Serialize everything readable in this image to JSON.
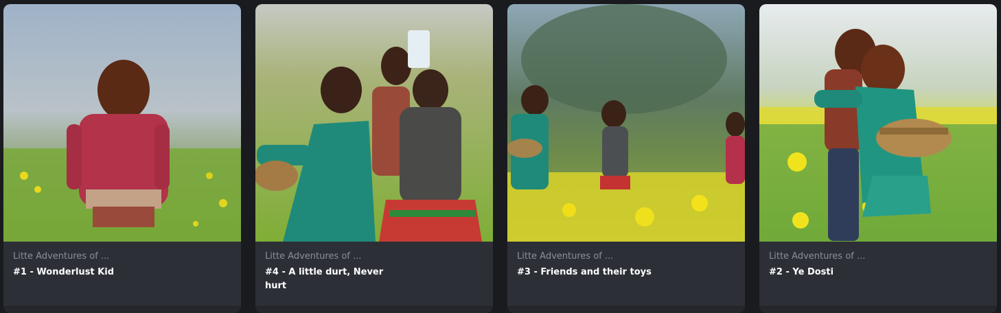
{
  "cards": [
    {
      "collection": "Litte Adventures of ...",
      "title": "#1 - Wonderlust Kid"
    },
    {
      "collection": "Litte Adventures of ...",
      "title": "#4 - A little durt, Never hurt"
    },
    {
      "collection": "Litte Adventures of ...",
      "title": "#3 - Friends and their toys"
    },
    {
      "collection": "Litte Adventures of ...",
      "title": "#2 - Ye Dosti"
    }
  ]
}
